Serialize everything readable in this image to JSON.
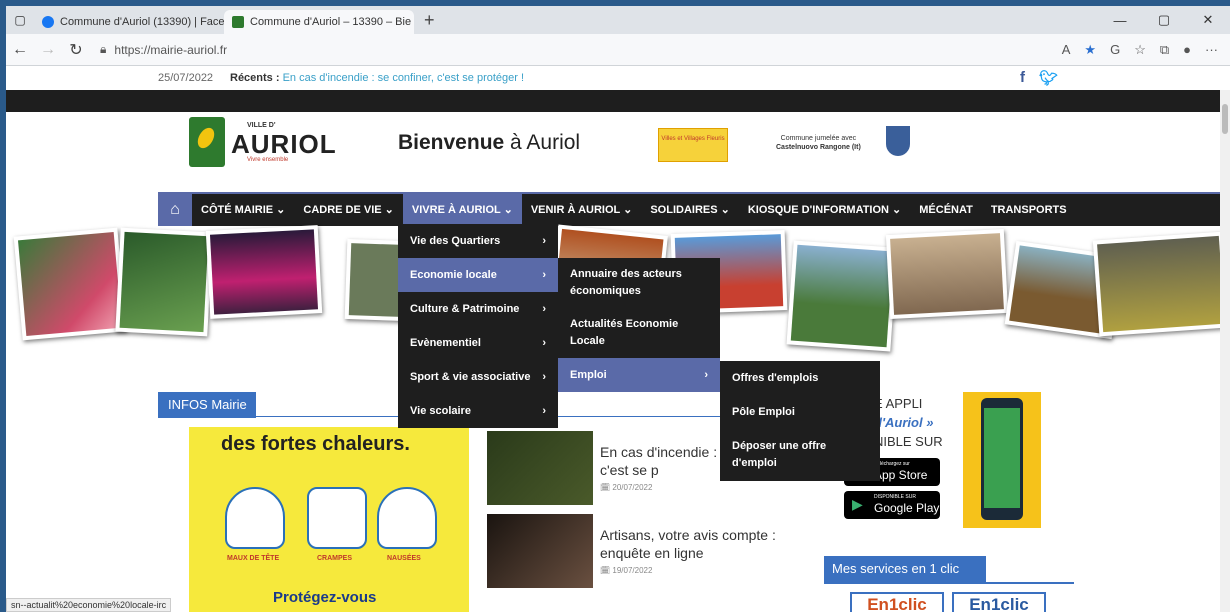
{
  "browser": {
    "tabs": [
      {
        "title": "Commune d'Auriol (13390) | Face",
        "favicon_color": "#1877f2"
      },
      {
        "title": "Commune d'Auriol – 13390 – Bie",
        "favicon_color": "#2e7a2e"
      }
    ],
    "url": "https://mairie-auriol.fr",
    "status_url": "sn--actualit%20economie%20locale-irc"
  },
  "topbar": {
    "date": "25/07/2022",
    "recents_label": "Récents :",
    "recents_text": "En cas d'incendie : se confiner, c'est se protéger !"
  },
  "header": {
    "logo_ville": "VILLE D'",
    "logo_name": "AURIOL",
    "logo_tagline": "Vivre ensemble",
    "welcome_bold": "Bienvenue",
    "welcome_rest": " à Auriol",
    "fleuris": "Villes et Villages Fleuris",
    "jumelage_1": "Commune jumelée avec",
    "jumelage_2": "Castelnuovo Rangone (It)"
  },
  "nav": {
    "items": [
      "CÔTÉ MAIRIE ⌄",
      "CADRE DE VIE ⌄",
      "VIVRE À AURIOL ⌄",
      "VENIR À AURIOL ⌄",
      "SOLIDAIRES ⌄",
      "KIOSQUE D'INFORMATION ⌄",
      "MÉCÉNAT",
      "TRANSPORTS"
    ],
    "active_index": 2
  },
  "menu_l1": [
    "Vie des Quartiers",
    "Economie locale",
    "Culture & Patrimoine",
    "Evènementiel",
    "Sport & vie associative",
    "Vie scolaire"
  ],
  "menu_l2": [
    "Annuaire des acteurs économiques",
    "Actualités Economie Locale",
    "Emploi"
  ],
  "menu_l3": [
    "Offres d'emplois",
    "Pôle Emploi",
    "Déposer une offre d'emploi"
  ],
  "infos": {
    "label": "INFOS Mairie",
    "poster_title": "des fortes chaleurs.",
    "poster_labels": [
      "MAUX DE TÊTE",
      "CRAMPES",
      "NAUSÉES"
    ],
    "poster_footer": "Protégez-vous"
  },
  "news": [
    {
      "title": "En cas d'incendie : se confiner, c'est se p",
      "date": "20/07/2022"
    },
    {
      "title": "Artisans, votre avis compte : enquête en ligne",
      "date": "19/07/2022"
    }
  ],
  "appli": {
    "line1": "E APPLI",
    "line2": "d'Auriol »",
    "line3": "NIBLE SUR",
    "appstore_small": "Téléchargez sur",
    "appstore": "App Store",
    "google_small": "DISPONIBLE SUR",
    "google": "Google Play"
  },
  "services": {
    "label": "Mes services en 1 clic",
    "en1clic": "En1clic"
  },
  "social": {
    "facebook": "f",
    "twitter": "🐦"
  }
}
